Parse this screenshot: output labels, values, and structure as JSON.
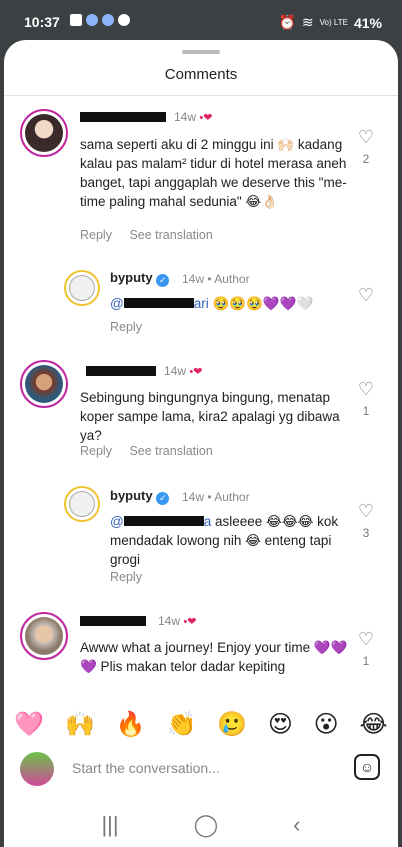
{
  "status_bar": {
    "time": "10:37",
    "battery": "41%",
    "signal": "Vo) LTE"
  },
  "sheet": {
    "title": "Comments"
  },
  "comments": [
    {
      "time": "14w",
      "body": "sama seperti aku di 2 minggu ini 🙌🏻 kadang kalau pas malam² tidur di hotel merasa aneh banget, tapi anggaplah we deserve this \"me-time paling mahal sedunia\" 😂👌🏻",
      "reply": "Reply",
      "see_translation": "See translation",
      "likes": "2"
    },
    {
      "username": "byputy",
      "time": "14w",
      "author_label": "Author",
      "mention": "@",
      "mention_suffix": "ari",
      "body": "🥹🥹🥹💜💜🤍",
      "reply": "Reply",
      "likes": ""
    },
    {
      "time": "14w",
      "body": "Sebingung bingungnya bingung, menatap koper sampe lama, kira2 apalagi yg dibawa ya?",
      "reply": "Reply",
      "see_translation": "See translation",
      "likes": "1"
    },
    {
      "username": "byputy",
      "time": "14w",
      "author_label": "Author",
      "mention": "@",
      "mention_suffix": "a",
      "body": "asleeee 😂😂😂 kok mendadak lowong nih 😂 enteng tapi grogi",
      "reply": "Reply",
      "likes": "3"
    },
    {
      "time": "14w",
      "body": "Awww what a journey! Enjoy your time 💜💜💜 Plis makan telor dadar kepiting",
      "likes": "1"
    }
  ],
  "emoji_bar": [
    "🩷",
    "🙌",
    "🔥",
    "👏",
    "🥲",
    "😍",
    "😮",
    "😂"
  ],
  "composer": {
    "placeholder": "Start the conversation..."
  },
  "nav": {
    "recents": "|||",
    "home": "◯",
    "back": "‹"
  }
}
